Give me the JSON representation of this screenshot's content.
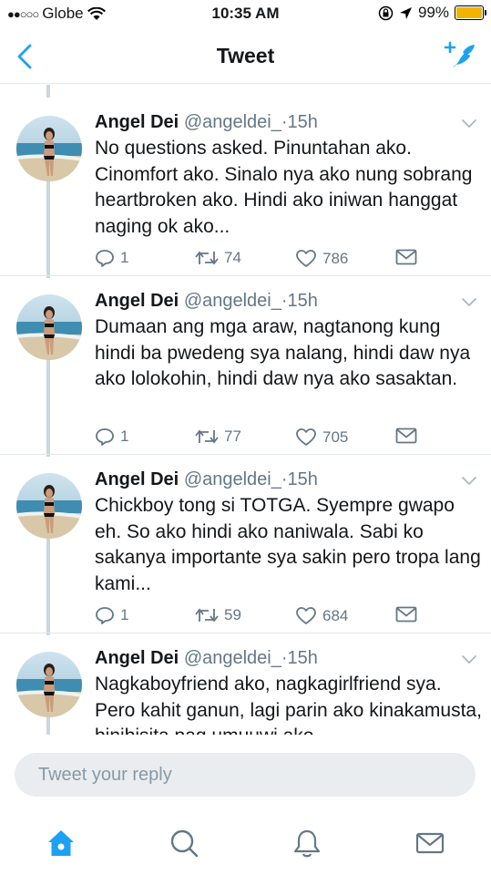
{
  "status_bar": {
    "signal": "●●○○○",
    "carrier": "Globe",
    "time": "10:35 AM",
    "battery": "99%",
    "battery_level": 0.99,
    "battery_color": "#f3b400"
  },
  "nav": {
    "title": "Tweet",
    "accent_color": "#1da1f2"
  },
  "tweets": [
    {
      "name": "Angel Dei",
      "handle": "@angeldei_",
      "separator": "·",
      "time": "15h",
      "text": "No questions asked. Pinuntahan ako. Cinomfort ako. Sinalo nya ako nung sobrang heartbroken ako. Hindi ako iniwan hanggat naging ok ako...",
      "replies": "1",
      "retweets": "74",
      "likes": "786"
    },
    {
      "name": "Angel Dei",
      "handle": "@angeldei_",
      "separator": "·",
      "time": "15h",
      "text": "Dumaan ang mga araw, nagtanong kung hindi ba pwedeng sya nalang, hindi daw nya ako lolokohin, hindi daw nya ako sasaktan.",
      "replies": "1",
      "retweets": "77",
      "likes": "705"
    },
    {
      "name": "Angel Dei",
      "handle": "@angeldei_",
      "separator": "·",
      "time": "15h",
      "text": "Chickboy tong si TOTGA. Syempre gwapo eh. So ako hindi ako naniwala. Sabi ko sakanya importante sya sakin pero tropa lang kami...",
      "replies": "1",
      "retweets": "59",
      "likes": "684"
    },
    {
      "name": "Angel Dei",
      "handle": "@angeldei_",
      "separator": "·",
      "time": "15h",
      "text": "Nagkaboyfriend ako, nagkagirlfriend sya. Pero kahit ganun, lagi parin ako kinakamusta, binibisita pag umuuwi ako",
      "replies": "",
      "retweets": "",
      "likes": ""
    }
  ],
  "reply": {
    "placeholder": "Tweet your reply"
  },
  "tab_bar": {
    "items": [
      "home-icon",
      "search-icon",
      "notifications-icon",
      "messages-icon"
    ],
    "active_color": "#1da1f2",
    "inactive_color": "#657786"
  }
}
